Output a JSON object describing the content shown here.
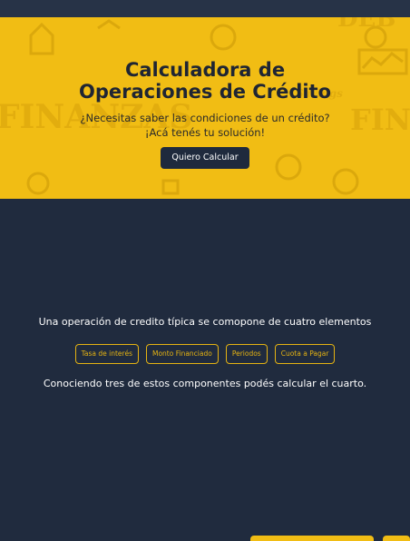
{
  "hero": {
    "title_line1": "Calculadora de",
    "title_line2": "Operaciones de Crédito",
    "subtitle_line1": "¿Necesitas saber las condiciones de un crédito?",
    "subtitle_line2": "¡Acá tenés tu solución!",
    "cta_label": "Quiero Calcular",
    "background_words": [
      "FINANZAS",
      "FIN",
      "DEB",
      "Savings"
    ]
  },
  "info": {
    "intro": "Una operación de credito típica se comopone de cuatro elementos",
    "elements": [
      "Tasa de interés",
      "Monto Financiado",
      "Periodos",
      "Cuota a Pagar"
    ],
    "conclusion": "Conociendo tres de estos componentes podés calcular el cuarto."
  },
  "colors": {
    "accent": "#f1bd14",
    "background": "#202b3e",
    "button_dark": "#1f2a3d",
    "pill_border": "#e5b312"
  }
}
